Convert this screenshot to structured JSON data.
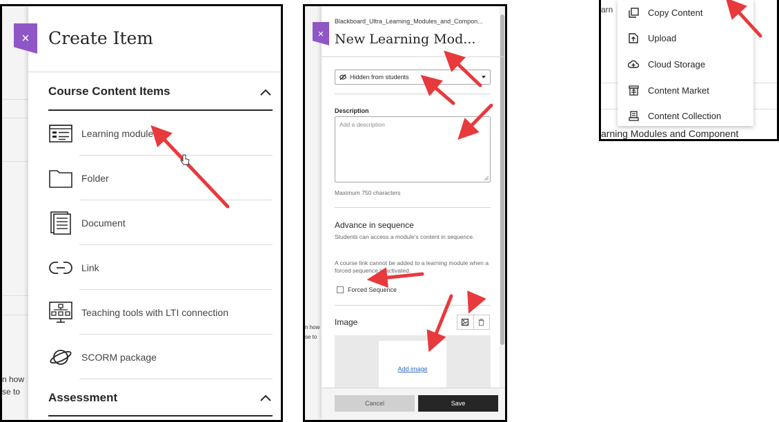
{
  "create_item": {
    "title": "Create Item",
    "close_icon": "×",
    "sections": {
      "course_content": "Course Content Items",
      "assessment": "Assessment"
    },
    "items": [
      {
        "label": "Learning module",
        "icon": "learning-module-icon"
      },
      {
        "label": "Folder",
        "icon": "folder-icon"
      },
      {
        "label": "Document",
        "icon": "document-icon"
      },
      {
        "label": "Link",
        "icon": "link-icon"
      },
      {
        "label": "Teaching tools with LTI connection",
        "icon": "lti-tools-icon"
      },
      {
        "label": "SCORM package",
        "icon": "scorm-package-icon"
      }
    ],
    "background_fragments": [
      "n how",
      "se to"
    ]
  },
  "module_panel": {
    "breadcrumb": "Blackboard_Ultra_Learning_Modules_and_Compon...",
    "title": "New Learning Mod...",
    "close_icon": "×",
    "visibility": "Hidden from students",
    "description_label": "Description",
    "description_placeholder": "Add a description",
    "max_chars": "Maximum 750 characters",
    "advance_heading": "Advance in sequence",
    "advance_text": "Students can access a module's content in sequence.",
    "course_link_note": "A course link cannot be added to a learning module when a forced sequence is activated.",
    "forced_sequence_label": "Forced Sequence",
    "image_label": "Image",
    "add_image": "Add image",
    "cancel": "Cancel",
    "save": "Save",
    "background_fragments": [
      "n how",
      "se to"
    ]
  },
  "add_menu": {
    "items": [
      {
        "label": "Copy Content",
        "icon": "copy-content-icon"
      },
      {
        "label": "Upload",
        "icon": "upload-icon"
      },
      {
        "label": "Cloud Storage",
        "icon": "cloud-storage-icon"
      },
      {
        "label": "Content Market",
        "icon": "content-market-icon"
      },
      {
        "label": "Content Collection",
        "icon": "content-collection-icon"
      }
    ],
    "fragment_left": "arn",
    "fragment_bottom": "arning Modules and Component"
  },
  "colors": {
    "accent_purple": "#8f56c6",
    "arrow_red": "#e8393d",
    "link_blue": "#2d6ac4"
  }
}
